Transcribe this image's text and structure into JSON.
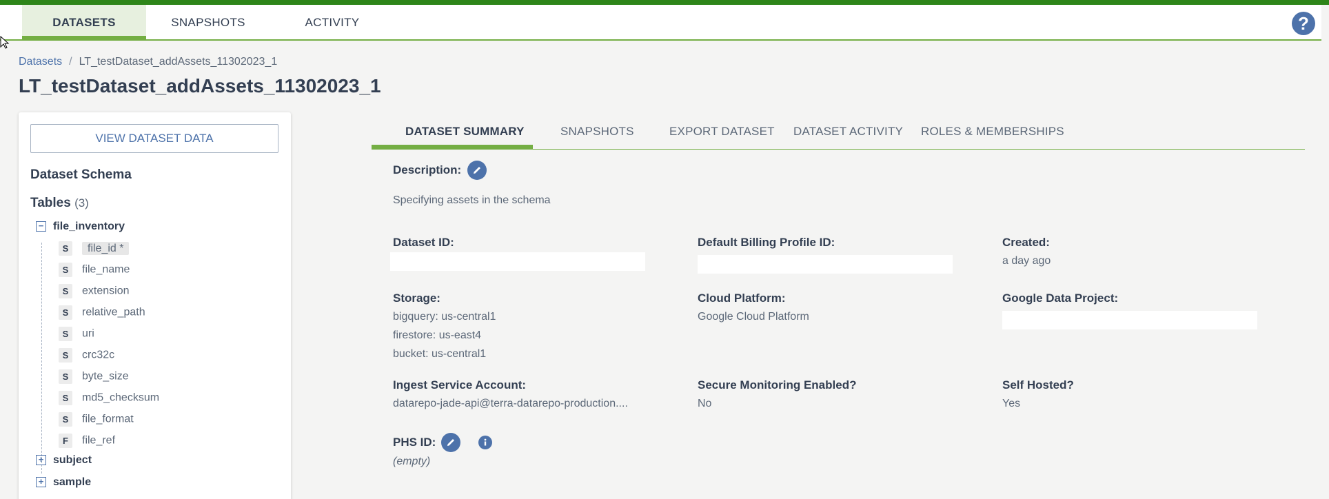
{
  "topnav": {
    "tabs": [
      {
        "label": "DATASETS"
      },
      {
        "label": "SNAPSHOTS"
      },
      {
        "label": "ACTIVITY"
      }
    ],
    "help_label": "?"
  },
  "breadcrumb": {
    "root": "Datasets",
    "separator": "/",
    "current": "LT_testDataset_addAssets_11302023_1"
  },
  "page_title": "LT_testDataset_addAssets_11302023_1",
  "schema_panel": {
    "view_button": "VIEW DATASET DATA",
    "schema_title": "Dataset Schema",
    "tables_label": "Tables",
    "tables_count": "(3)",
    "tables": [
      {
        "name": "file_inventory",
        "expanded": true,
        "toggle": "−"
      },
      {
        "name": "subject",
        "expanded": false,
        "toggle": "+"
      },
      {
        "name": "sample",
        "expanded": false,
        "toggle": "+"
      }
    ],
    "columns": [
      {
        "type": "S",
        "name": "file_id *",
        "primary": true
      },
      {
        "type": "S",
        "name": "file_name"
      },
      {
        "type": "S",
        "name": "extension"
      },
      {
        "type": "S",
        "name": "relative_path"
      },
      {
        "type": "S",
        "name": "uri"
      },
      {
        "type": "S",
        "name": "crc32c"
      },
      {
        "type": "S",
        "name": "byte_size"
      },
      {
        "type": "S",
        "name": "md5_checksum"
      },
      {
        "type": "S",
        "name": "file_format"
      },
      {
        "type": "F",
        "name": "file_ref"
      }
    ]
  },
  "detail_tabs": [
    {
      "label": "DATASET SUMMARY",
      "active": true
    },
    {
      "label": "SNAPSHOTS"
    },
    {
      "label": "EXPORT DATASET"
    },
    {
      "label": "DATASET ACTIVITY"
    },
    {
      "label": "ROLES & MEMBERSHIPS"
    }
  ],
  "summary": {
    "description_label": "Description:",
    "description": "Specifying assets in the schema",
    "dataset_id_label": "Dataset ID:",
    "billing_label": "Default Billing Profile ID:",
    "created_label": "Created:",
    "created": "a day ago",
    "storage_label": "Storage:",
    "storage": [
      "bigquery: us-central1",
      "firestore: us-east4",
      "bucket: us-central1"
    ],
    "cloud_label": "Cloud Platform:",
    "cloud": "Google Cloud Platform",
    "gdp_label": "Google Data Project:",
    "ingest_label": "Ingest Service Account:",
    "ingest": "datarepo-jade-api@terra-datarepo-production....",
    "secure_label": "Secure Monitoring Enabled?",
    "secure": "No",
    "selfhosted_label": "Self Hosted?",
    "selfhosted": "Yes",
    "phs_label": "PHS ID:",
    "phs": "(empty)"
  },
  "colors": {
    "accent": "#74ae43",
    "brand": "#2e8519",
    "link": "#4d72aa",
    "text": "#333f52"
  }
}
